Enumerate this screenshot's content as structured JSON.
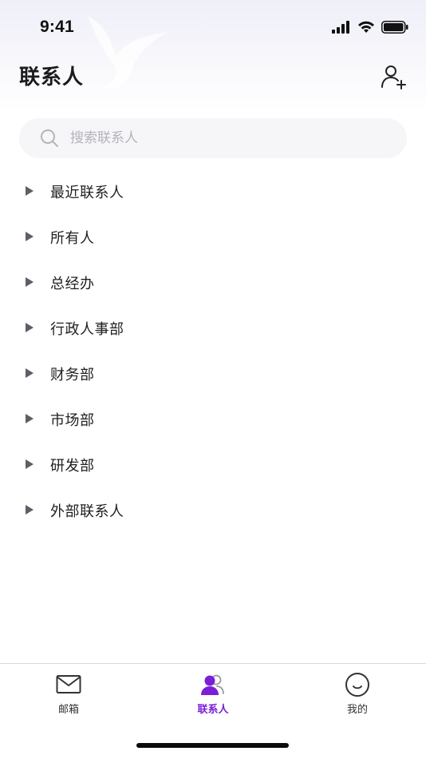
{
  "status_bar": {
    "time": "9:41"
  },
  "header": {
    "title": "联系人",
    "add_contact_icon": "person-add-icon"
  },
  "search": {
    "placeholder": "搜索联系人",
    "icon": "search-icon"
  },
  "groups": [
    {
      "label": "最近联系人"
    },
    {
      "label": "所有人"
    },
    {
      "label": "总经办"
    },
    {
      "label": "行政人事部"
    },
    {
      "label": "财务部"
    },
    {
      "label": "市场部"
    },
    {
      "label": "研发部"
    },
    {
      "label": "外部联系人"
    }
  ],
  "tab_bar": {
    "tabs": [
      {
        "label": "邮箱",
        "icon": "mail-icon",
        "active": false
      },
      {
        "label": "联系人",
        "icon": "contacts-icon",
        "active": true
      },
      {
        "label": "我的",
        "icon": "smiley-face-icon",
        "active": false
      }
    ]
  },
  "colors": {
    "accent": "#7a1fd6",
    "text": "#1f1f1f",
    "caret": "#5e5f66",
    "search_bg": "#f6f6f8"
  }
}
